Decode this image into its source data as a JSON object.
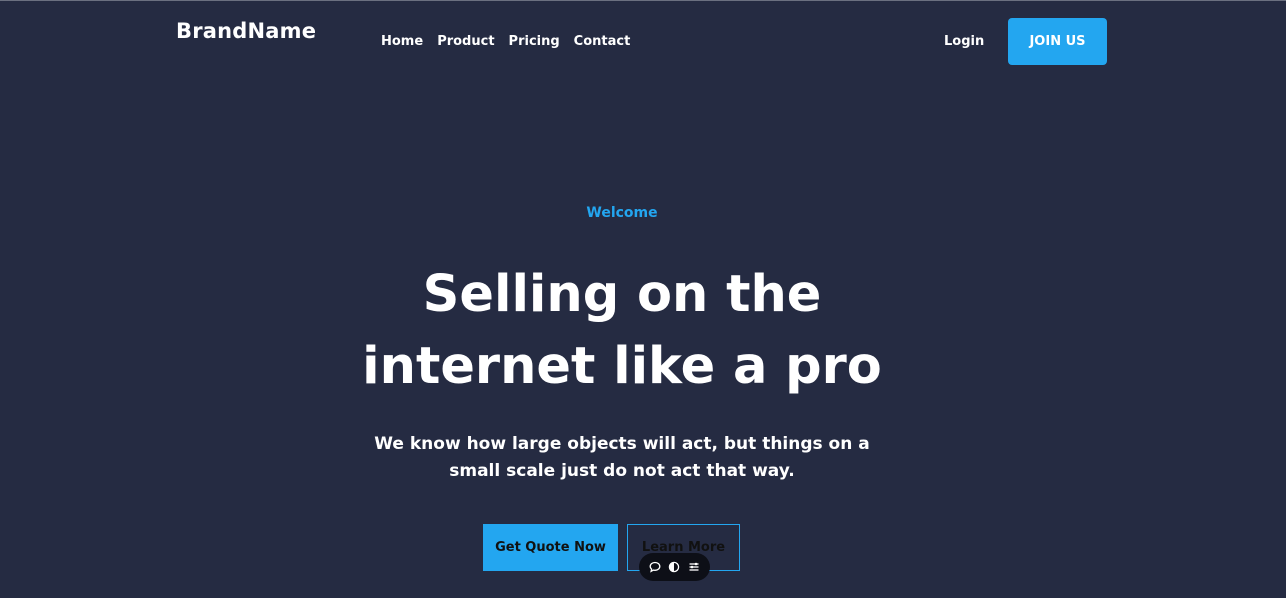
{
  "header": {
    "brand": "BrandName",
    "nav": [
      "Home",
      "Product",
      "Pricing",
      "Contact"
    ],
    "login_label": "Login",
    "join_label": "JOIN US"
  },
  "hero": {
    "eyebrow": "Welcome",
    "title": "Selling on the internet like a pro",
    "description": "We know how large objects will act, but things on a small scale just do not act that way.",
    "primary_cta": "Get Quote Now",
    "secondary_cta": "Learn More"
  },
  "floating_toolbar": {
    "icons": [
      "chat-bubble-icon",
      "toggle-icon",
      "menu-lines-icon"
    ]
  },
  "colors": {
    "background": "#252b42",
    "accent": "#23a6f0",
    "text": "#ffffff"
  }
}
